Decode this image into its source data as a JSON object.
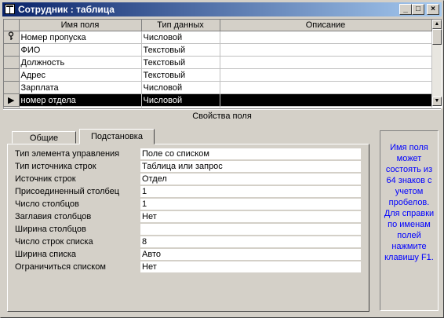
{
  "window": {
    "title": "Сотрудник : таблица",
    "minimize": "_",
    "maximize": "□",
    "close": "×"
  },
  "grid": {
    "columns": [
      "Имя поля",
      "Тип данных",
      "Описание"
    ],
    "rows": [
      {
        "name": "Номер пропуска",
        "type": "Числовой",
        "description": "",
        "key": true
      },
      {
        "name": "ФИО",
        "type": "Текстовый",
        "description": ""
      },
      {
        "name": "Должность",
        "type": "Текстовый",
        "description": ""
      },
      {
        "name": "Адрес",
        "type": "Текстовый",
        "description": ""
      },
      {
        "name": "Зарплата",
        "type": "Числовой",
        "description": ""
      },
      {
        "name": "номер отдела",
        "type": "Числовой",
        "description": "",
        "selected": true
      },
      {
        "name": "",
        "type": "",
        "description": ""
      }
    ],
    "selected_row_marker": "▶",
    "key_icon": "key-icon"
  },
  "properties": {
    "header": "Свойства поля",
    "tabs": [
      {
        "label": "Общие",
        "active": false
      },
      {
        "label": "Подстановка",
        "active": true
      }
    ],
    "rows": [
      {
        "label": "Тип элемента управления",
        "value": "Поле со списком"
      },
      {
        "label": "Тип источника строк",
        "value": "Таблица или запрос"
      },
      {
        "label": "Источник строк",
        "value": "Отдел"
      },
      {
        "label": "Присоединенный столбец",
        "value": "1"
      },
      {
        "label": "Число столбцов",
        "value": "1"
      },
      {
        "label": "Заглавия столбцов",
        "value": "Нет"
      },
      {
        "label": "Ширина столбцов",
        "value": ""
      },
      {
        "label": "Число строк списка",
        "value": "8"
      },
      {
        "label": "Ширина списка",
        "value": "Авто"
      },
      {
        "label": "Ограничиться списком",
        "value": "Нет"
      }
    ],
    "help_text": "Имя поля может состоять из 64 знаков с учетом пробелов. Для справки по именам полей нажмите клавишу F1."
  },
  "colors": {
    "title_start": "#0a246a",
    "title_end": "#a6caf0",
    "help_text": "#0000ff",
    "face": "#d4d0c8"
  }
}
